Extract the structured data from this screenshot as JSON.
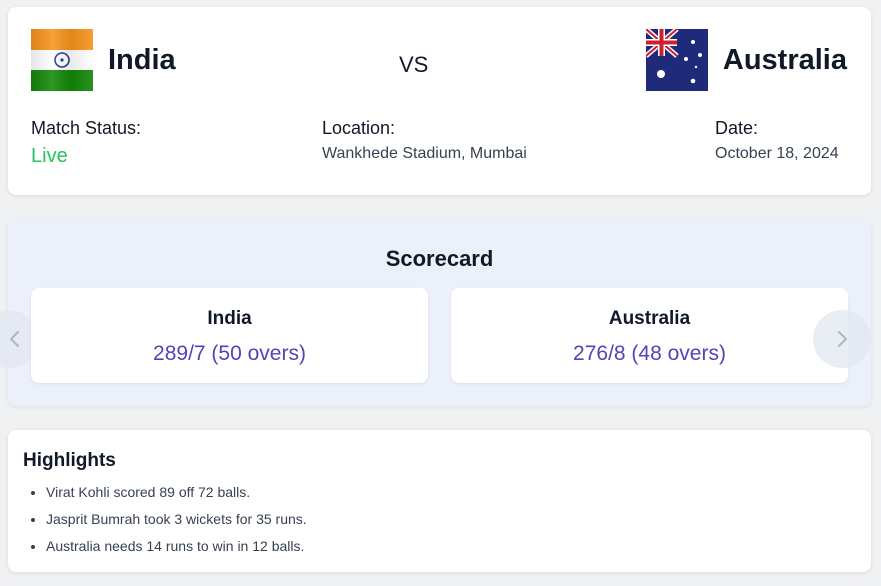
{
  "match": {
    "team1": {
      "name": "India",
      "flag_icon": "india-flag-icon"
    },
    "vs_label": "VS",
    "team2": {
      "name": "Australia",
      "flag_icon": "australia-flag-icon"
    },
    "status": {
      "label": "Match Status:",
      "value": "Live",
      "color": "#22c55e"
    },
    "location": {
      "label": "Location:",
      "value": "Wankhede Stadium, Mumbai"
    },
    "date": {
      "label": "Date:",
      "value": "October 18, 2024"
    }
  },
  "scorecard": {
    "title": "Scorecard",
    "teams": [
      {
        "name": "India",
        "score": "289/7 (50 overs)"
      },
      {
        "name": "Australia",
        "score": "276/8 (48 overs)"
      }
    ],
    "score_color": "#4f46b8",
    "background": "#ebf0fb"
  },
  "highlights": {
    "title": "Highlights",
    "items": [
      "Virat Kohli scored 89 off 72 balls.",
      "Jasprit Bumrah took 3 wickets for 35 runs.",
      "Australia needs 14 runs to win in 12 balls."
    ]
  }
}
